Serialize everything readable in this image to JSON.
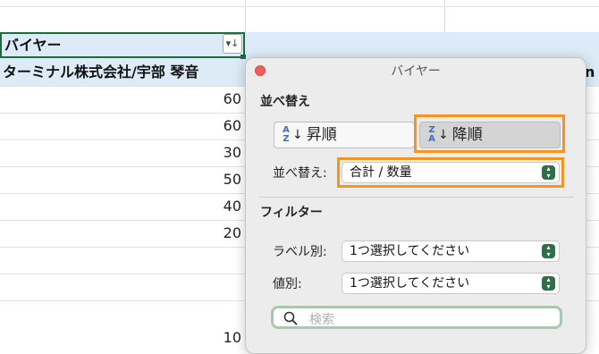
{
  "sheet": {
    "header_cell": "バイヤー",
    "filter_button_icon": "sort-filter-icon",
    "row2_label": "ターミナル株式会社/宇部 琴音",
    "right_clip_text": "n",
    "values": [
      "60",
      "60",
      "30",
      "50",
      "40",
      "20",
      "10"
    ]
  },
  "popover": {
    "title": "バイヤー",
    "sort_section": "並べ替え",
    "ascending_label": "昇順",
    "descending_label": "降順",
    "sort_by_label": "並べ替え:",
    "sort_by_value": "合計 / 数量",
    "filter_section": "フィルター",
    "by_label_label": "ラベル別:",
    "by_label_value": "1つ選択してください",
    "by_value_label": "値別:",
    "by_value_value": "1つ選択してください",
    "search_placeholder": "検索",
    "highlight_color": "#f7941d"
  }
}
